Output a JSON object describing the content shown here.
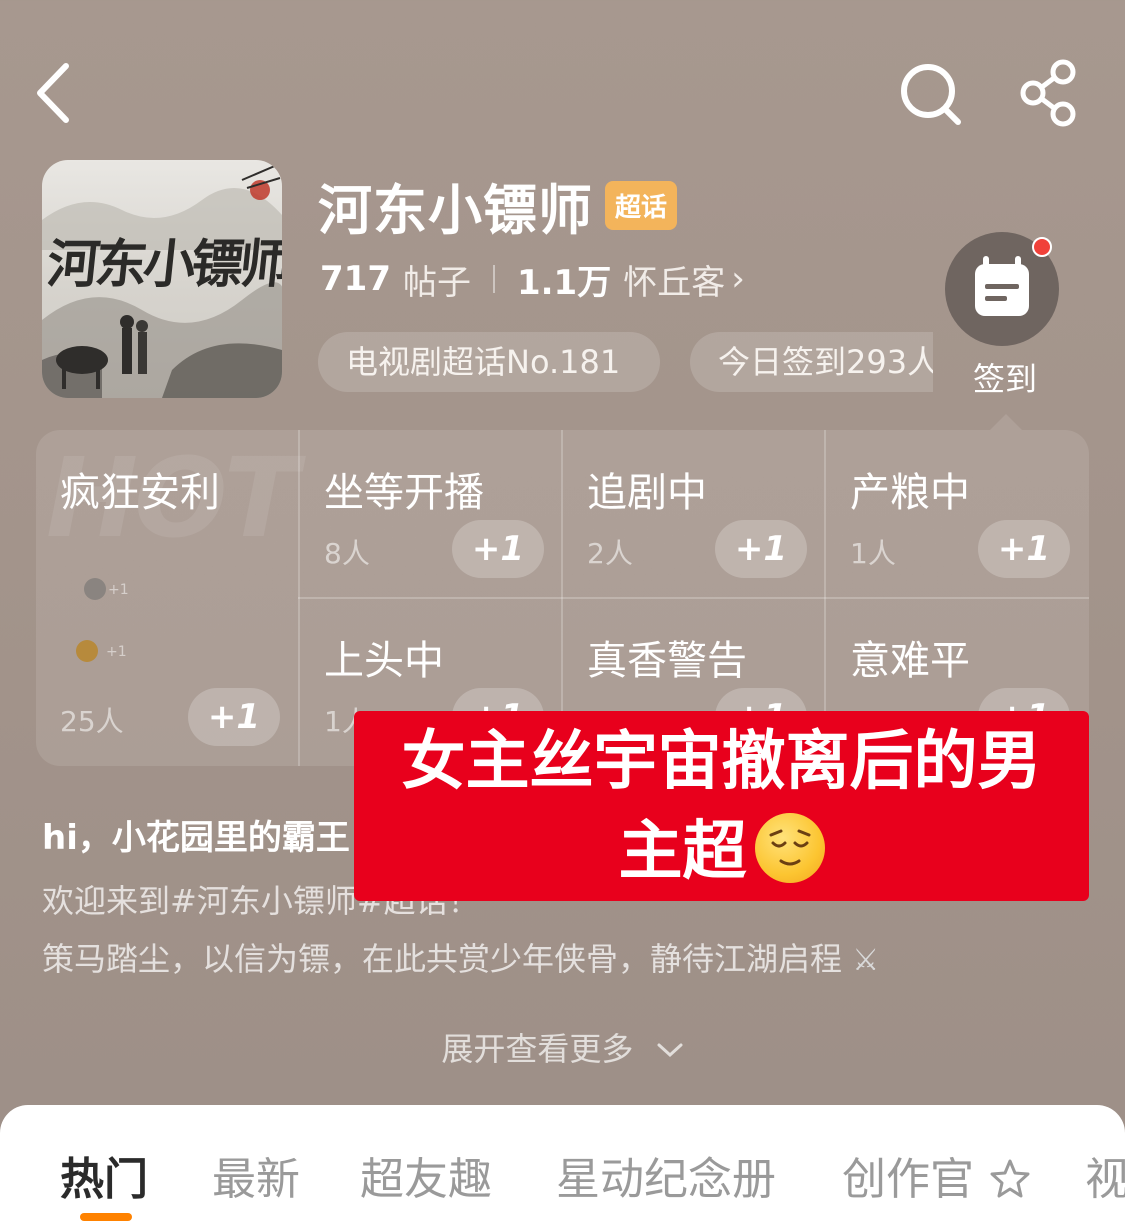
{
  "header": {
    "back_icon": "chevron-left-icon",
    "search_icon": "search-icon",
    "share_icon": "share-icon"
  },
  "topic": {
    "cover_text": "河东小镖师",
    "title": "河东小镖师",
    "badge": "超话",
    "posts_count": "717",
    "posts_label": "帖子",
    "members_count": "1.1万",
    "members_label": "怀丘客",
    "rank_chip": "电视剧超话No.181",
    "signed_chip": "今日签到293人",
    "checkin_label": "签到"
  },
  "grid": {
    "hot": {
      "title": "疯狂安利",
      "count": "25人",
      "plus": "+1",
      "watermark": "HOT"
    },
    "cells": [
      {
        "title": "坐等开播",
        "count": "8人",
        "plus": "+1"
      },
      {
        "title": "追剧中",
        "count": "2人",
        "plus": "+1"
      },
      {
        "title": "产粮中",
        "count": "1人",
        "plus": "+1"
      },
      {
        "title": "上头中",
        "count": "1人",
        "plus": "+1"
      },
      {
        "title": "真香警告",
        "count": "",
        "plus": "+1"
      },
      {
        "title": "意难平",
        "count": "",
        "plus": "+1"
      }
    ]
  },
  "description": {
    "greeting": "hi，小花园里的霸王",
    "line1": "欢迎来到#河东小镖师#超话！",
    "line2": "策马踏尘，以信为镖，在此共赏少年侠骨，静待江湖启程",
    "expand": "展开查看更多"
  },
  "overlay": {
    "line1": "女主丝宇宙撤离后的男",
    "line2": "主超"
  },
  "tabs": [
    "热门",
    "最新",
    "超友趣",
    "星动纪念册",
    "创作官",
    "视"
  ],
  "colors": {
    "accent": "#ff8200",
    "badge": "#f3b45b",
    "overlay": "#e8001c",
    "background": "#a59690"
  }
}
